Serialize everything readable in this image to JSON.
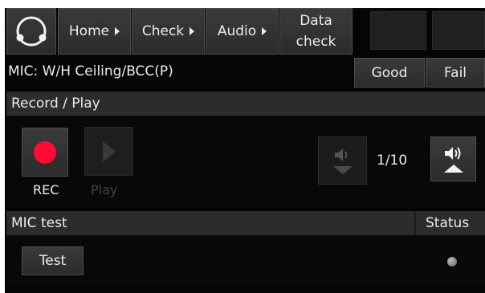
{
  "nav": {
    "home": "Home",
    "check": "Check",
    "audio": "Audio",
    "data_check_line1": "Data",
    "data_check_line2": "check"
  },
  "mic_label": "MIC: W/H Ceiling/BCC(P)",
  "good_label": "Good",
  "fail_label": "Fail",
  "record_play": {
    "title": "Record / Play",
    "rec_label": "REC",
    "play_label": "Play",
    "volume_value": "1/10"
  },
  "mic_test": {
    "title": "MIC test",
    "status_header": "Status",
    "test_label": "Test"
  },
  "colors": {
    "rec_dot": "#ff0b35",
    "status_led": "#8a8a8a"
  }
}
